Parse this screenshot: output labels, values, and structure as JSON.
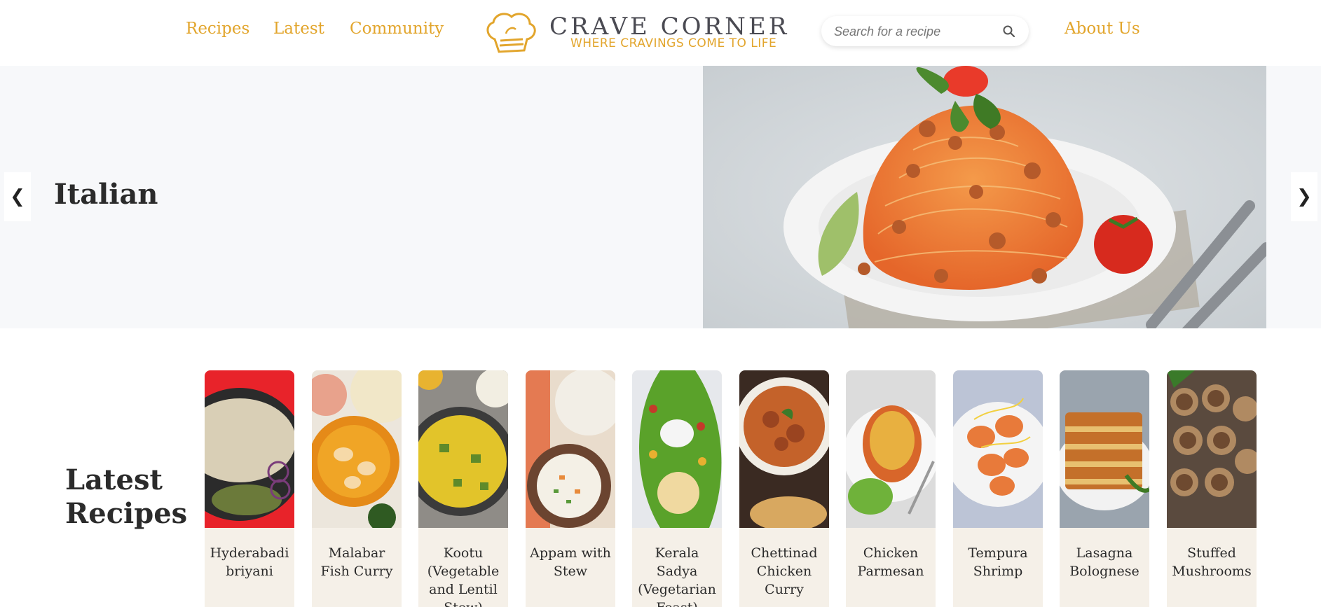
{
  "header": {
    "nav_left": [
      "Recipes",
      "Latest",
      "Community"
    ],
    "nav_right": "About Us",
    "logo": {
      "title": "CRAVE CORNER",
      "tagline": "WHERE CRAVINGS COME TO LIFE"
    },
    "search": {
      "placeholder": "Search for a recipe",
      "value": ""
    }
  },
  "hero": {
    "title": "Italian",
    "prev_label": "❮",
    "next_label": "❯"
  },
  "latest": {
    "heading_line1": "Latest",
    "heading_line2": "Recipes",
    "cards": [
      {
        "title": "Hyderabadi briyani"
      },
      {
        "title": "Malabar Fish Curry"
      },
      {
        "title": "Kootu (Vegetable and Lentil Stew)"
      },
      {
        "title": "Appam with Stew"
      },
      {
        "title": "Kerala Sadya (Vegetarian Feast)"
      },
      {
        "title": "Chettinad Chicken Curry"
      },
      {
        "title": "Chicken Parmesan"
      },
      {
        "title": "Tempura Shrimp"
      },
      {
        "title": "Lasagna Bolognese"
      },
      {
        "title": "Stuffed Mushrooms"
      }
    ]
  },
  "colors": {
    "accent": "#e2a52c",
    "heading": "#2b2b2b",
    "card_bg": "#f5f0e8",
    "hero_bg": "#f7f8fa"
  }
}
